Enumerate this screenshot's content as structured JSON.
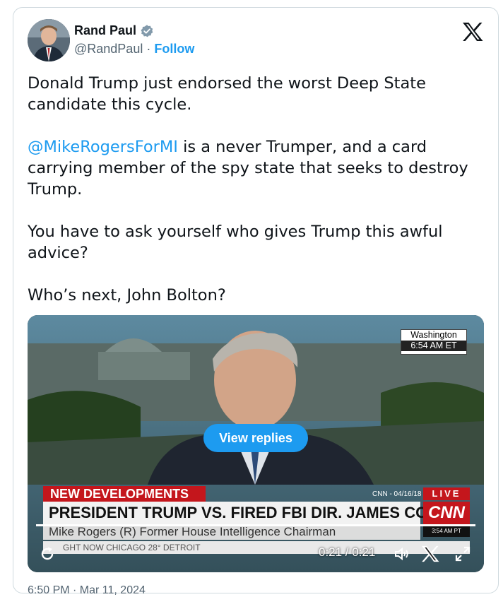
{
  "tweet": {
    "author_name": "Rand Paul",
    "handle": "@RandPaul",
    "separator": " · ",
    "follow_label": "Follow",
    "paragraphs": {
      "p1": "Donald Trump just endorsed the worst Deep State candidate this cycle.",
      "p2_mention": "@MikeRogersForMI",
      "p2_rest": " is a never Trumper, and a card carrying member of the spy state that seeks to destroy Trump.",
      "p3": "You have to ask yourself who gives Trump this awful advice?",
      "p4": "Who’s next, John Bolton?"
    },
    "timestamp_partial": "6:50 PM · Mar 11, 2024"
  },
  "video": {
    "location_label": "Washington",
    "location_time": "6:54 AM ET",
    "view_replies_label": "View replies",
    "chyron_top": "NEW DEVELOPMENTS",
    "chyron_main": "PRESIDENT TRUMP VS. FIRED FBI DIR. JAMES COMEY",
    "chyron_sub": "Mike Rogers   (R) Former House Intelligence Chairman",
    "cnn_date": "CNN - 04/16/18",
    "live_label": "LIVE",
    "cnn_logo": "CNN",
    "small_time": "3:54 AM PT",
    "ticker": "GHT NOW      CHICAGO    28°      DETROIT",
    "time_display": "0:21 / 0:21",
    "progress": 1.0
  },
  "colors": {
    "accent": "#1d9bf0",
    "cnn_red": "#c4161c",
    "muted": "#536471"
  },
  "icons": [
    "verified-badge-icon",
    "x-logo-icon",
    "replay-icon",
    "volume-icon",
    "x-watermark-icon",
    "fullscreen-icon"
  ]
}
